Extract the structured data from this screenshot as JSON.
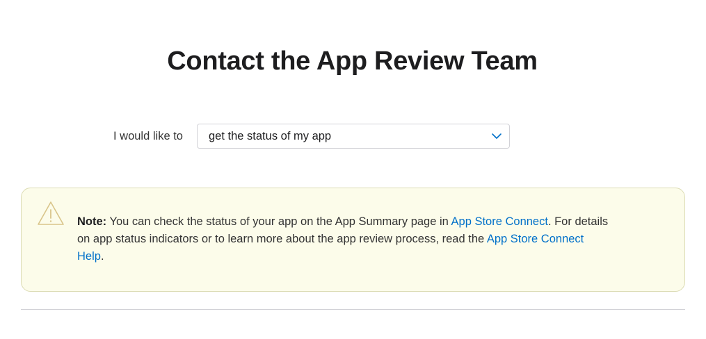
{
  "page": {
    "title": "Contact the App Review Team"
  },
  "request": {
    "label": "I would like to",
    "selected_option": "get the status of my app"
  },
  "note": {
    "prefix": "Note:",
    "text_1": " You can check the status of your app on the App Summary page in ",
    "link_1": "App Store Connect",
    "text_2": ". For details on app status indicators or to learn more about the app review process, read the ",
    "link_2": "App Store Connect Help",
    "text_3": ".",
    "icon": "warning-triangle-icon"
  },
  "colors": {
    "link": "#0070c9",
    "note_background": "#fcfcea",
    "note_border": "#dcdcb4",
    "chevron": "#0070c9"
  }
}
